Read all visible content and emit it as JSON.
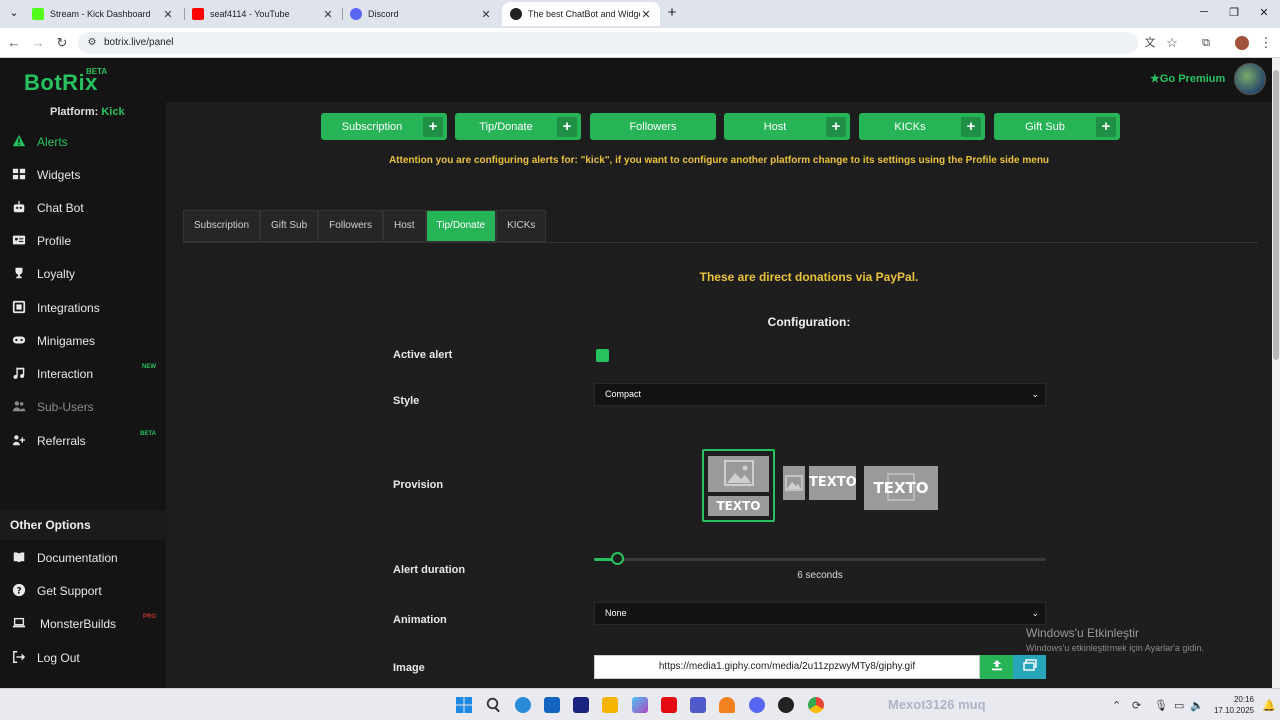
{
  "browser": {
    "tabs": [
      {
        "title": "Stream - Kick Dashboard",
        "color": "#53fc18"
      },
      {
        "title": "seaf4114 - YouTube",
        "color": "#ff0000"
      },
      {
        "title": "Discord",
        "color": "#5865f2"
      },
      {
        "title": "The best ChatBot and Widgets",
        "color": "#222222"
      }
    ],
    "url": "botrix.live/panel"
  },
  "brand": {
    "name": "BotRix",
    "badge": "BETA",
    "premium": "Go Premium",
    "accent": "#27c25f",
    "warning": "#e8c23a"
  },
  "sidebar": {
    "platform_label": "Platform:",
    "platform_value": "Kick",
    "items": [
      {
        "label": "Alerts",
        "icon": "warning-icon"
      },
      {
        "label": "Widgets",
        "icon": "grid-icon"
      },
      {
        "label": "Chat Bot",
        "icon": "robot-icon"
      },
      {
        "label": "Profile",
        "icon": "id-card-icon"
      },
      {
        "label": "Loyalty",
        "icon": "trophy-icon"
      },
      {
        "label": "Integrations",
        "icon": "integration-icon"
      },
      {
        "label": "Minigames",
        "icon": "gamepad-icon"
      },
      {
        "label": "Interaction",
        "icon": "music-icon",
        "badge": "NEW"
      },
      {
        "label": "Sub-Users",
        "icon": "users-icon"
      },
      {
        "label": "Referrals",
        "icon": "referral-icon",
        "badge": "BETA"
      }
    ],
    "other_heading": "Other Options",
    "other_items": [
      {
        "label": "Documentation",
        "icon": "book-icon"
      },
      {
        "label": "Get Support",
        "icon": "help-icon"
      },
      {
        "label": "MonsterBuilds",
        "icon": "laptop-icon",
        "badge": "PRO"
      },
      {
        "label": "Log Out",
        "icon": "logout-icon"
      }
    ]
  },
  "alert_types": [
    {
      "label": "Subscription",
      "plus": "+"
    },
    {
      "label": "Tip/Donate",
      "plus": "+"
    },
    {
      "label": "Followers"
    },
    {
      "label": "Host",
      "plus": "+"
    },
    {
      "label": "KICKs",
      "plus": "+"
    },
    {
      "label": "Gift Sub",
      "plus": "+"
    }
  ],
  "attention": "Attention you are configuring alerts for: \"kick\", if you want to configure another platform change to its settings using the Profile side menu",
  "subtabs": [
    "Subscription",
    "Gift Sub",
    "Followers",
    "Host",
    "Tip/Donate",
    "KICKs"
  ],
  "config": {
    "description": "These are direct donations via PayPal.",
    "heading": "Configuration:",
    "active_alert_label": "Active alert",
    "active_alert": true,
    "style_label": "Style",
    "style_value": "Compact",
    "provision_label": "Provision",
    "provision_text": "TEXTO",
    "duration_label": "Alert duration",
    "duration_value": 6,
    "duration_text": "6 seconds",
    "animation_label": "Animation",
    "animation_value": "None",
    "image_label": "Image",
    "image_url": "https://media1.giphy.com/media/2u11zpzwyMTy8/giphy.gif"
  },
  "windows": {
    "activate_title": "Windows'u Etkinleştir",
    "activate_sub": "Windows'u etkinleştirmek için Ayarlar'a gidin.",
    "time": "20:16",
    "date": "17.10.2025"
  }
}
